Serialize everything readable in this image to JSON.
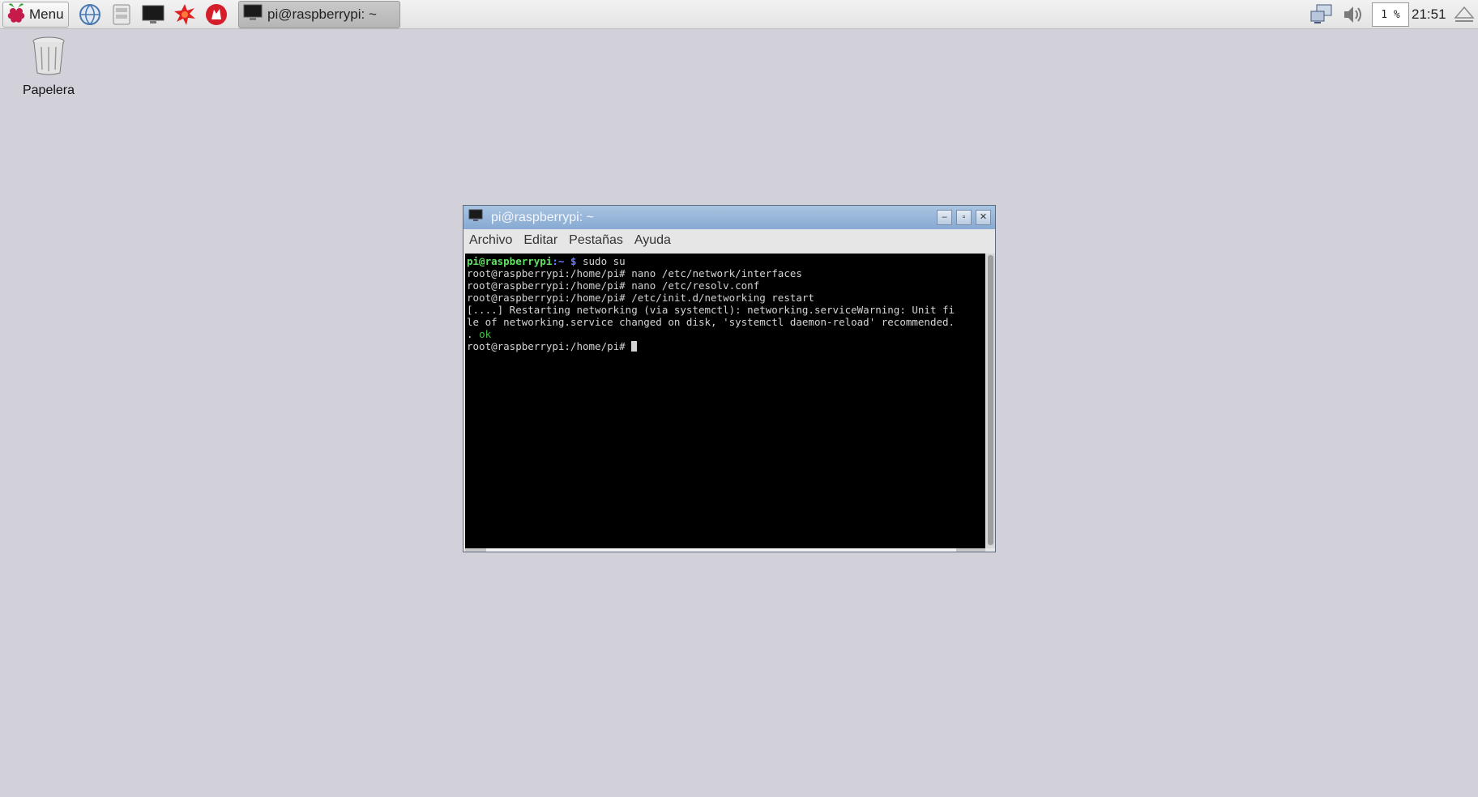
{
  "taskbar": {
    "menu_label": "Menu",
    "launchers": [
      "browser-icon",
      "file-manager-icon",
      "terminal-icon",
      "mathematica-icon",
      "wolfram-icon"
    ],
    "task": {
      "title": "pi@raspberrypi: ~"
    },
    "cpu": "1 %",
    "clock": "21:51"
  },
  "desktop": {
    "icons": [
      {
        "label": "Papelera",
        "icon": "trash-icon"
      }
    ]
  },
  "window": {
    "title": "pi@raspberrypi: ~",
    "menu": [
      "Archivo",
      "Editar",
      "Pestañas",
      "Ayuda"
    ],
    "terminal": {
      "prompt_user": "pi@raspberrypi",
      "prompt_sep": ":~ $",
      "first_cmd": " sudo su",
      "lines": [
        "root@raspberrypi:/home/pi# nano /etc/network/interfaces",
        "root@raspberrypi:/home/pi# nano /etc/resolv.conf",
        "root@raspberrypi:/home/pi# /etc/init.d/networking restart",
        "[....] Restarting networking (via systemctl): networking.serviceWarning: Unit fi",
        "le of networking.service changed on disk, 'systemctl daemon-reload' recommended."
      ],
      "dot": ". ",
      "ok": "ok",
      "final_prompt": "root@raspberrypi:/home/pi# "
    }
  },
  "colors": {
    "desktop_bg": "#d2d1da",
    "titlebar": "#87a9d2",
    "terminal_bg": "#000000",
    "prompt_green": "#5fe35f",
    "prompt_blue": "#6a7cff"
  }
}
